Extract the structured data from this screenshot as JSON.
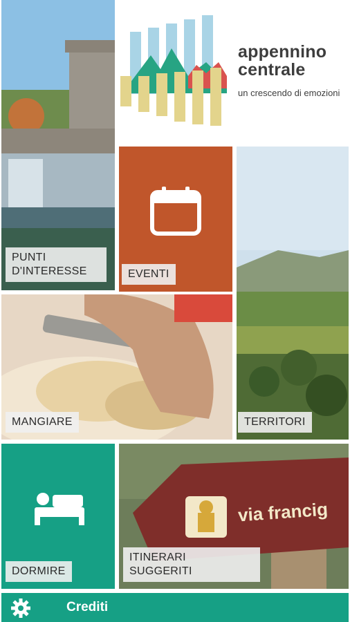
{
  "brand": {
    "title_line1": "appennino",
    "title_line2": "centrale",
    "tagline": "un crescendo di emozioni",
    "logo": "appennino-centrale-logo"
  },
  "tiles": {
    "punti": {
      "label": "PUNTI\nD'INTERESSE"
    },
    "eventi": {
      "label": "EVENTI",
      "icon": "calendar-icon"
    },
    "territori": {
      "label": "TERRITORI"
    },
    "mangiare": {
      "label": "MANGIARE"
    },
    "dormire": {
      "label": "DORMIRE",
      "icon": "bed-icon"
    },
    "itinerari": {
      "label": "ITINERARI\nSUGGERITI",
      "sign_text": "via francig"
    }
  },
  "footer": {
    "credits_label": "Crediti",
    "icon": "gear-icon"
  },
  "colors": {
    "eventi": "#c0562b",
    "dormire": "#16a085",
    "footer": "#16a085"
  }
}
